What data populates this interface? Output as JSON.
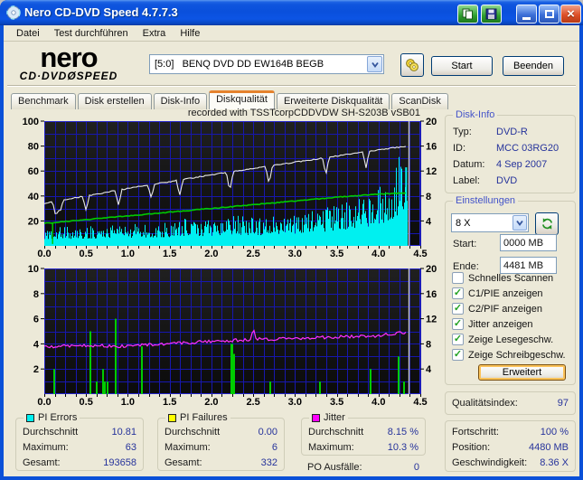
{
  "window": {
    "title": "Nero CD-DVD Speed 4.7.7.3"
  },
  "titlebar_icons": [
    "copy-icon",
    "save-icon",
    "minimize-icon",
    "maximize-icon",
    "close-icon"
  ],
  "menu": {
    "items": [
      "Datei",
      "Test durchführen",
      "Extra",
      "Hilfe"
    ]
  },
  "header": {
    "logo_line1": "nero",
    "logo_line2": "CD·DVDØSPEED",
    "drive_value": "[5:0]   BENQ DVD DD EW164B BEGB",
    "start_label": "Start",
    "quit_label": "Beenden"
  },
  "tabs": {
    "items": [
      "Benchmark",
      "Disk erstellen",
      "Disk-Info",
      "Diskqualität",
      "Erweiterte Diskqualität",
      "ScanDisk"
    ],
    "active": "Diskqualität"
  },
  "disk_info": {
    "title": "Disk-Info",
    "rows": [
      {
        "label": "Typ:",
        "value": "DVD-R"
      },
      {
        "label": "ID:",
        "value": "MCC 03RG20"
      },
      {
        "label": "Datum:",
        "value": "4 Sep 2007"
      },
      {
        "label": "Label:",
        "value": "DVD"
      }
    ]
  },
  "settings": {
    "title": "Einstellungen",
    "speed_value": "8 X",
    "fields": [
      {
        "label": "Start:",
        "value": "0000 MB"
      },
      {
        "label": "Ende:",
        "value": "4481 MB"
      }
    ],
    "checkboxes": [
      {
        "label": "Schnelles Scannen",
        "checked": false
      },
      {
        "label": "C1/PIE anzeigen",
        "checked": true
      },
      {
        "label": "C2/PIF anzeigen",
        "checked": true
      },
      {
        "label": "Jitter anzeigen",
        "checked": true
      },
      {
        "label": "Zeige Lesegeschw.",
        "checked": true
      },
      {
        "label": "Zeige Schreibgeschw.",
        "checked": true
      }
    ],
    "advanced_label": "Erweitert"
  },
  "quality": {
    "label": "Qualitätsindex:",
    "value": "97"
  },
  "progress": {
    "rows": [
      {
        "label": "Fortschritt:",
        "value": "100 %"
      },
      {
        "label": "Position:",
        "value": "4480 MB"
      },
      {
        "label": "Geschwindigkeit:",
        "value": "8.36 X"
      }
    ]
  },
  "stats": [
    {
      "title": "PI Errors",
      "color": "#00F0F0",
      "rows": [
        {
          "label": "Durchschnitt",
          "value": "10.81"
        },
        {
          "label": "Maximum:",
          "value": "63"
        },
        {
          "label": "Gesamt:",
          "value": "193658"
        }
      ]
    },
    {
      "title": "PI Failures",
      "color": "#FFFF00",
      "rows": [
        {
          "label": "Durchschnitt",
          "value": "0.00"
        },
        {
          "label": "Maximum:",
          "value": "6"
        },
        {
          "label": "Gesamt:",
          "value": "332"
        }
      ]
    },
    {
      "title": "Jitter",
      "color": "#FF00FF",
      "rows": [
        {
          "label": "Durchschnitt",
          "value": "8.15 %"
        },
        {
          "label": "Maximum:",
          "value": "10.3 %"
        }
      ],
      "extra": {
        "label": "PO Ausfälle:",
        "value": "0"
      }
    }
  ],
  "colors": {
    "dialog_bg": "#ECE9D8",
    "plot_grid": "#1717AE",
    "value_text": "#26339B",
    "active_tab_accent": "#E5822D"
  },
  "chart_data": [
    {
      "type": "area",
      "title": "recorded with TSSTcorpCDDVDW SH-S203B  vSB01",
      "x_range": [
        0,
        4.5
      ],
      "x_ticks": [
        "0.0",
        "0.5",
        "1.0",
        "1.5",
        "2.0",
        "2.5",
        "3.0",
        "3.5",
        "4.0",
        "4.5"
      ],
      "x_minor_step": 0.125,
      "grid": true,
      "y_left": {
        "range": [
          0,
          100
        ],
        "ticks": [
          20,
          40,
          60,
          80,
          100
        ],
        "minor_step": 10
      },
      "y_right": {
        "range": [
          0,
          20
        ],
        "ticks": [
          4,
          8,
          12,
          16,
          20
        ]
      },
      "series": [
        {
          "name": "PI Errors",
          "color": "#00F0F0",
          "style": "noise-area",
          "avg": 10.81,
          "max": 63,
          "envelope": [
            [
              0,
              11
            ],
            [
              0.5,
              11.5
            ],
            [
              1,
              13
            ],
            [
              1.5,
              14
            ],
            [
              2,
              16
            ],
            [
              2.3,
              18
            ],
            [
              2.6,
              17
            ],
            [
              3,
              19
            ],
            [
              3.3,
              22
            ],
            [
              3.6,
              26
            ],
            [
              3.9,
              31
            ],
            [
              4.1,
              38
            ],
            [
              4.2,
              46
            ],
            [
              4.3,
              58
            ],
            [
              4.34,
              63
            ]
          ],
          "end_x": 4.345
        },
        {
          "name": "Schreibgeschwindigkeit",
          "color": "#E8E8E8",
          "style": "line",
          "points": [
            [
              0,
              34
            ],
            [
              0.5,
              40
            ],
            [
              1,
              46
            ],
            [
              1.5,
              51.5
            ],
            [
              2,
              57
            ],
            [
              2.5,
              62
            ],
            [
              3,
              67
            ],
            [
              3.5,
              72
            ],
            [
              4,
              77
            ],
            [
              4.34,
              80
            ]
          ],
          "dips": [
            [
              0.14,
              13
            ],
            [
              0.19,
              9
            ],
            [
              0.5,
              12
            ],
            [
              0.89,
              13
            ],
            [
              1.28,
              11
            ],
            [
              1.62,
              13
            ],
            [
              2.22,
              16
            ],
            [
              2.69,
              15
            ],
            [
              3.37,
              14
            ],
            [
              3.85,
              13
            ]
          ]
        },
        {
          "name": "Lesegeschwindigkeit",
          "color": "#00CC00",
          "style": "line",
          "points": [
            [
              0,
              18
            ],
            [
              0.5,
              21
            ],
            [
              1,
              24
            ],
            [
              1.5,
              27
            ],
            [
              2,
              30
            ],
            [
              2.5,
              33
            ],
            [
              3,
              36
            ],
            [
              3.5,
              39
            ],
            [
              4,
              41.5
            ],
            [
              4.34,
              42.5
            ]
          ],
          "drops": [
            [
              0.1,
              1.5
            ]
          ]
        }
      ],
      "end_marker_x": 4.365
    },
    {
      "type": "mixed",
      "title": "",
      "x_range": [
        0,
        4.5
      ],
      "x_ticks": [
        "0.0",
        "0.5",
        "1.0",
        "1.5",
        "2.0",
        "2.5",
        "3.0",
        "3.5",
        "4.0",
        "4.5"
      ],
      "x_minor_step": 0.125,
      "grid": true,
      "y_left": {
        "range": [
          0,
          10
        ],
        "ticks": [
          2,
          4,
          6,
          8,
          10
        ],
        "minor_step": 1
      },
      "y_right": {
        "range": [
          0,
          20
        ],
        "ticks": [
          4,
          8,
          12,
          16,
          20
        ]
      },
      "series": [
        {
          "name": "PI Failures",
          "color": "#00CC00",
          "style": "bars",
          "max": 6,
          "total": 332,
          "bars": [
            [
              0.12,
              2
            ],
            [
              0.55,
              5
            ],
            [
              0.63,
              1
            ],
            [
              0.7,
              2
            ],
            [
              0.73,
              1
            ],
            [
              0.76,
              1
            ],
            [
              0.85,
              6
            ],
            [
              1.17,
              3.8
            ],
            [
              2.24,
              4
            ],
            [
              2.27,
              3.2
            ],
            [
              2.7,
              1
            ],
            [
              3.3,
              1
            ],
            [
              3.9,
              2
            ],
            [
              4.24,
              3
            ],
            [
              4.3,
              1
            ]
          ]
        },
        {
          "name": "Jitter",
          "color": "#FF30FF",
          "style": "noise-line",
          "avg_pct": 8.15,
          "max_pct": 10.3,
          "points": [
            [
              0,
              3.75
            ],
            [
              0.5,
              3.9
            ],
            [
              0.9,
              3.8
            ],
            [
              1.5,
              4.0
            ],
            [
              2.0,
              4.2
            ],
            [
              2.5,
              4.35
            ],
            [
              3.0,
              4.45
            ],
            [
              3.5,
              4.55
            ],
            [
              4.0,
              4.65
            ],
            [
              4.34,
              4.95
            ]
          ],
          "noise": 0.13,
          "spikes": [
            [
              2.5,
              1.2
            ]
          ],
          "end_x": 4.345
        }
      ],
      "end_marker_x": 4.365
    }
  ]
}
